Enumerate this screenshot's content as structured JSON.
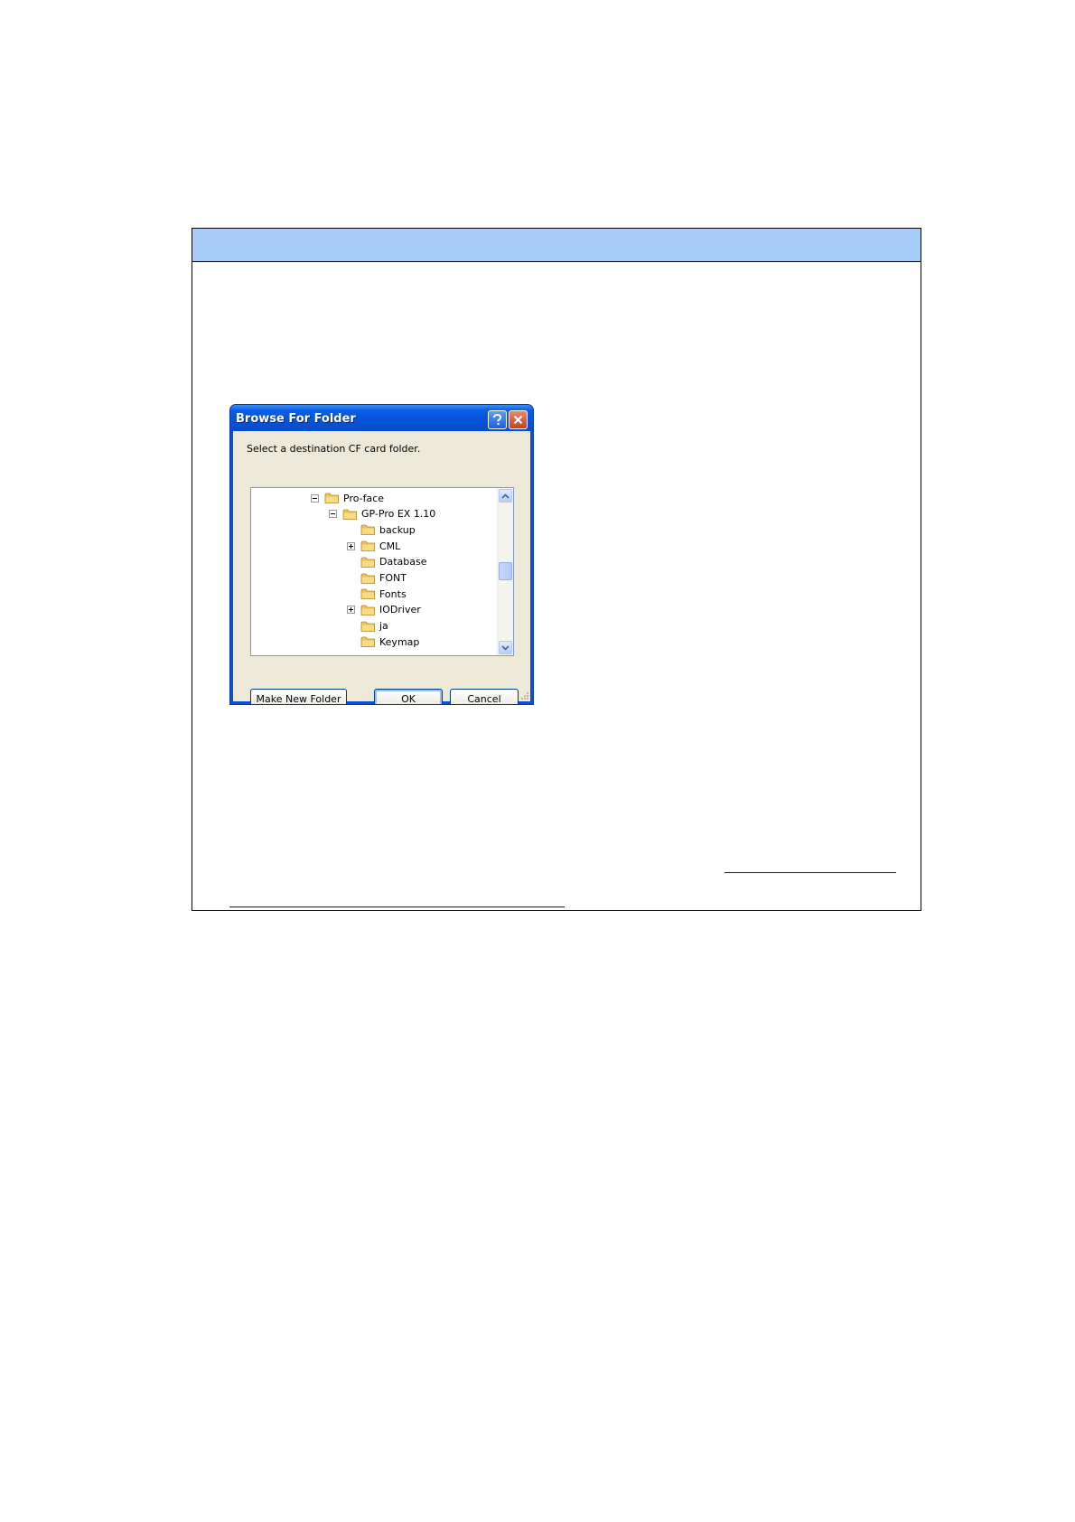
{
  "dialog": {
    "title": "Browse For Folder",
    "prompt": "Select a destination CF card folder.",
    "tree": [
      {
        "label": "Pro-face",
        "level": 0,
        "expander": "minus"
      },
      {
        "label": "GP-Pro EX 1.10",
        "level": 1,
        "expander": "minus"
      },
      {
        "label": "backup",
        "level": 2,
        "expander": "none"
      },
      {
        "label": "CML",
        "level": 2,
        "expander": "plus"
      },
      {
        "label": "Database",
        "level": 2,
        "expander": "none"
      },
      {
        "label": "FONT",
        "level": 2,
        "expander": "none"
      },
      {
        "label": "Fonts",
        "level": 2,
        "expander": "none"
      },
      {
        "label": "IODriver",
        "level": 2,
        "expander": "plus"
      },
      {
        "label": "ja",
        "level": 2,
        "expander": "none"
      },
      {
        "label": "Keymap",
        "level": 2,
        "expander": "none"
      }
    ],
    "buttons": {
      "make_new_folder": "Make New Folder",
      "ok": "OK",
      "cancel": "Cancel"
    }
  },
  "colors": {
    "header_fill": "#a8ccf8",
    "title_bar": "#0553d8",
    "link": "#0000ff"
  }
}
